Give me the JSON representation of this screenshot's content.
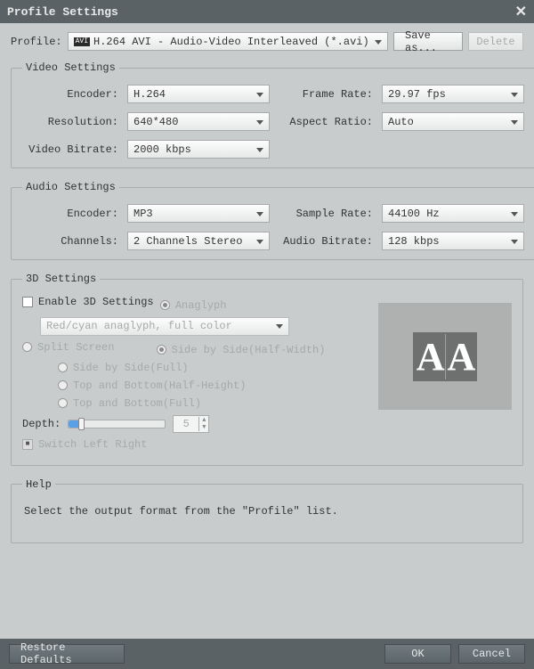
{
  "window": {
    "title": "Profile Settings"
  },
  "profile": {
    "label": "Profile:",
    "badge": "AVI",
    "value": "H.264 AVI - Audio-Video Interleaved (*.avi)",
    "saveAs": "Save as...",
    "delete": "Delete"
  },
  "video": {
    "legend": "Video Settings",
    "encoderLabel": "Encoder:",
    "encoder": "H.264",
    "frameRateLabel": "Frame Rate:",
    "frameRate": "29.97 fps",
    "resolutionLabel": "Resolution:",
    "resolution": "640*480",
    "aspectLabel": "Aspect Ratio:",
    "aspect": "Auto",
    "bitrateLabel": "Video Bitrate:",
    "bitrate": "2000 kbps"
  },
  "audio": {
    "legend": "Audio Settings",
    "encoderLabel": "Encoder:",
    "encoder": "MP3",
    "sampleLabel": "Sample Rate:",
    "sample": "44100 Hz",
    "channelsLabel": "Channels:",
    "channels": "2 Channels Stereo",
    "bitrateLabel": "Audio Bitrate:",
    "bitrate": "128 kbps"
  },
  "threeD": {
    "legend": "3D Settings",
    "enable": "Enable 3D Settings",
    "anaglyph": "Anaglyph",
    "anaglyphMode": "Red/cyan anaglyph, full color",
    "split": "Split Screen",
    "sbsHalf": "Side by Side(Half-Width)",
    "sbsFull": "Side by Side(Full)",
    "tbHalf": "Top and Bottom(Half-Height)",
    "tbFull": "Top and Bottom(Full)",
    "depthLabel": "Depth:",
    "depthVal": "5",
    "switchLR": "Switch Left Right"
  },
  "help": {
    "legend": "Help",
    "text": "Select the output format from the \"Profile\" list."
  },
  "footer": {
    "restore": "Restore Defaults",
    "ok": "OK",
    "cancel": "Cancel"
  }
}
